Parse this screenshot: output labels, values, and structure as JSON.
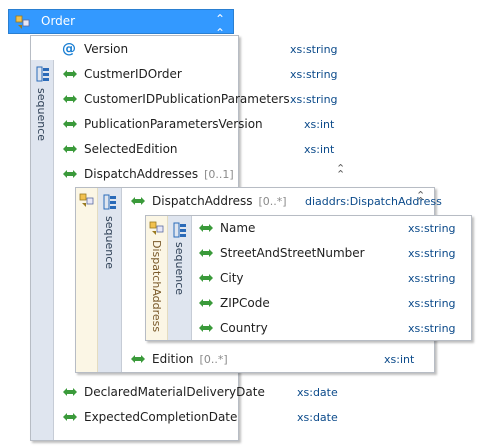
{
  "order": {
    "title": "Order",
    "sequence_label": "sequence",
    "elements": [
      {
        "name": "Version",
        "type": "xs:string",
        "kind": "attribute"
      },
      {
        "name": "CustmerIDOrder",
        "type": "xs:string",
        "kind": "element"
      },
      {
        "name": "CustomerIDPublicationParameters",
        "type": "xs:string",
        "kind": "element"
      },
      {
        "name": "PublicationParametersVersion",
        "type": "xs:int",
        "kind": "element"
      },
      {
        "name": "SelectedEdition",
        "type": "xs:int",
        "kind": "element"
      },
      {
        "name": "DispatchAddresses",
        "occurrence": "[0..1]",
        "kind": "element"
      },
      {
        "name": "DeclaredMaterialDeliveryDate",
        "type": "xs:date",
        "kind": "element"
      },
      {
        "name": "ExpectedCompletionDate",
        "type": "xs:date",
        "kind": "element"
      }
    ]
  },
  "dispatch_addresses": {
    "sequence_label": "sequence",
    "dispatch_address": {
      "name": "DispatchAddress",
      "occurrence": "[0..*]",
      "type": "diaddrs:DispatchAddress"
    },
    "edition": {
      "name": "Edition",
      "occurrence": "[0..*]",
      "type": "xs:int"
    }
  },
  "dispatch_address_type": {
    "type_label": "DispatchAddress",
    "sequence_label": "sequence",
    "fields": [
      {
        "name": "Name",
        "type": "xs:string"
      },
      {
        "name": "StreetAndStreetNumber",
        "type": "xs:string"
      },
      {
        "name": "City",
        "type": "xs:string"
      },
      {
        "name": "ZIPCode",
        "type": "xs:string"
      },
      {
        "name": "Country",
        "type": "xs:string"
      }
    ]
  },
  "colors": {
    "header_blue": "#3399ff",
    "element_icon_green": "#3a9a3a",
    "attribute_icon_blue": "#1a7fd4",
    "type_text": "#0b4a8a"
  },
  "icons": {
    "collapse": "chevron-up-double-icon",
    "element": "element-diamond-icon",
    "attribute": "attribute-at-icon",
    "sequence": "sequence-icon",
    "complex_type": "complex-type-icon"
  }
}
